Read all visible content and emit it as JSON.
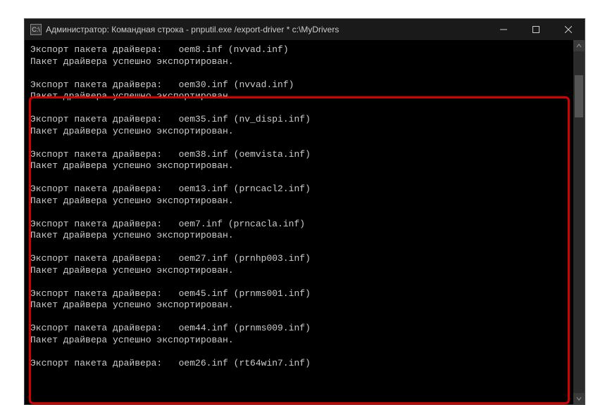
{
  "window": {
    "title": "Администратор: Командная строка - pnputil.exe  /export-driver * c:\\MyDrivers",
    "icon_label": "cmd-icon"
  },
  "controls": {
    "minimize": "minimize",
    "maximize": "maximize",
    "close": "close"
  },
  "labels": {
    "export_prefix": "Экспорт пакета драйвера:   ",
    "success": "Пакет драйвера успешно экспортирован."
  },
  "entries": [
    {
      "oem": "oem8.inf",
      "driver": "nvvad.inf",
      "show_success": true,
      "highlighted": false
    },
    {
      "oem": "oem30.inf",
      "driver": "nvvad.inf",
      "show_success": true,
      "highlighted": true
    },
    {
      "oem": "oem35.inf",
      "driver": "nv_dispi.inf",
      "show_success": true,
      "highlighted": true
    },
    {
      "oem": "oem38.inf",
      "driver": "oemvista.inf",
      "show_success": true,
      "highlighted": true
    },
    {
      "oem": "oem13.inf",
      "driver": "prncacl2.inf",
      "show_success": true,
      "highlighted": true
    },
    {
      "oem": "oem7.inf",
      "driver": "prncacla.inf",
      "show_success": true,
      "highlighted": true
    },
    {
      "oem": "oem27.inf",
      "driver": "prnhp003.inf",
      "show_success": true,
      "highlighted": true
    },
    {
      "oem": "oem45.inf",
      "driver": "prnms001.inf",
      "show_success": true,
      "highlighted": true
    },
    {
      "oem": "oem44.inf",
      "driver": "prnms009.inf",
      "show_success": true,
      "highlighted": true
    },
    {
      "oem": "oem26.inf",
      "driver": "rt64win7.inf",
      "show_success": false,
      "highlighted": true
    }
  ]
}
